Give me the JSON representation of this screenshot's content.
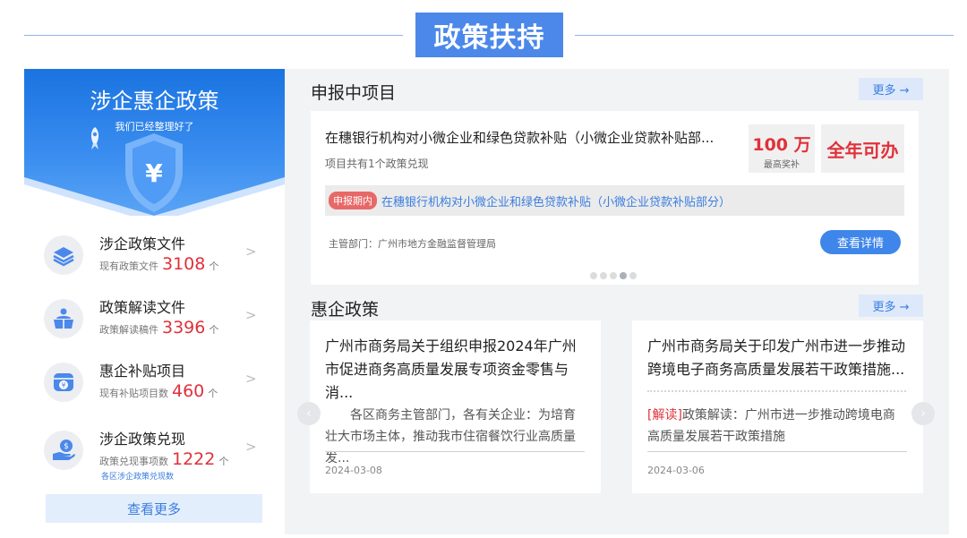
{
  "section": {
    "title": "政策扶持"
  },
  "left": {
    "banner_title": "涉企惠企政策",
    "banner_sub": "我们已经整理好了",
    "items": [
      {
        "title": "涉企政策文件",
        "label": "现有政策文件",
        "count": "3108",
        "unit": "个",
        "icon": "stack-doc-icon"
      },
      {
        "title": "政策解读文件",
        "label": "政策解读稿件",
        "count": "3396",
        "unit": "个",
        "icon": "reader-icon"
      },
      {
        "title": "惠企补贴项目",
        "label": "现有补贴项目数",
        "count": "460",
        "unit": "个",
        "icon": "coin-box-icon"
      },
      {
        "title": "涉企政策兑现",
        "label": "政策兑现事项数",
        "count": "1222",
        "unit": "个",
        "extra": "各区涉企政策兑现数",
        "icon": "hand-money-icon"
      }
    ],
    "view_more": "查看更多"
  },
  "projects": {
    "title": "申报中项目",
    "more": "更多 →",
    "card": {
      "title": "在穗银行机构对小微企业和绿色贷款补贴（小微企业贷款补贴部...",
      "sub": "项目共有1个政策兑现",
      "award_amount": "100 万",
      "award_label": "最高奖补",
      "period": "全年可办",
      "stage_badge": "申报期内",
      "stage_text": "在穗银行机构对小微企业和绿色贷款补贴（小微企业贷款补贴部分）",
      "dept": "主管部门：广州市地方金融监督管理局",
      "detail_btn": "查看详情"
    },
    "pager_dots": 5,
    "active_dot": 3
  },
  "policies": {
    "title": "惠企政策",
    "more": "更多 →",
    "cards": [
      {
        "title": "广州市商务局关于组织申报2024年广州市促进商务高质量发展专项资金零售与消...",
        "tag": "",
        "body": "各区商务主管部门，各有关企业：为培育壮大市场主体，推动我市住宿餐饮行业高质量发...",
        "date": "2024-03-08"
      },
      {
        "title": "广州市商务局关于印发广州市进一步推动跨境电子商务高质量发展若干政策措施...",
        "tag": "[解读]",
        "body": "政策解读：广州市进一步推动跨境电商高质量发展若干政策措施",
        "date": "2024-03-06"
      }
    ]
  },
  "colors": {
    "accent": "#4b88ea",
    "red": "#e0313a",
    "link": "#3a7de0"
  }
}
